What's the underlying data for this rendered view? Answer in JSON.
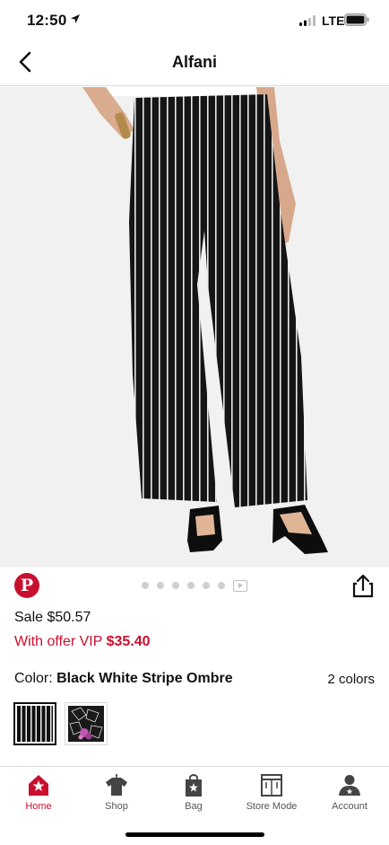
{
  "status_bar": {
    "time": "12:50",
    "network": "LTE"
  },
  "nav": {
    "title": "Alfani"
  },
  "gallery": {
    "image_count": 6,
    "active_index": 0,
    "has_video": true
  },
  "product": {
    "sale_price": "Sale $50.57",
    "offer_prefix": "With offer VIP ",
    "offer_price": "$35.40",
    "color_label": "Color: ",
    "color_name": "Black White Stripe Ombre",
    "color_count": "2 colors"
  },
  "tabs": [
    {
      "label": "Home",
      "icon": "home-icon",
      "active": true
    },
    {
      "label": "Shop",
      "icon": "shirt-icon"
    },
    {
      "label": "Bag",
      "icon": "bag-icon"
    },
    {
      "label": "Store Mode",
      "icon": "store-icon"
    },
    {
      "label": "Account",
      "icon": "account-icon"
    }
  ],
  "colors": {
    "accent": "#c8102e",
    "text": "#111111",
    "muted": "#555555"
  }
}
